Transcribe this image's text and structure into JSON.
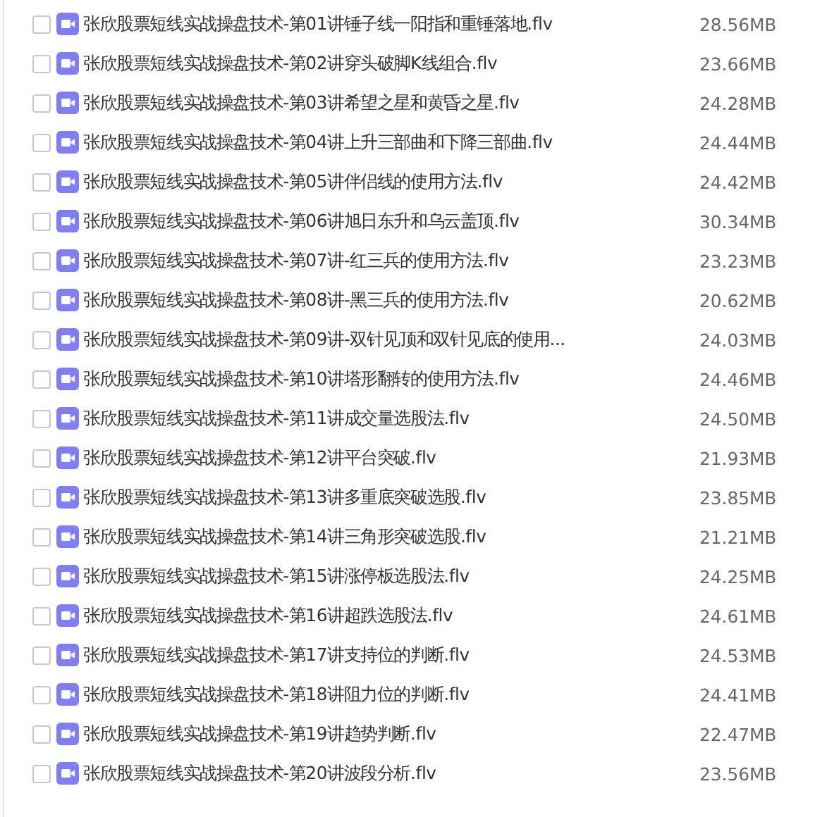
{
  "files": [
    {
      "name": "张欣股票短线实战操盘技术-第01讲锤子线一阳指和重锤落地.flv",
      "size": "28.56MB",
      "checked": false
    },
    {
      "name": "张欣股票短线实战操盘技术-第02讲穿头破脚K线组合.flv",
      "size": "23.66MB",
      "checked": false
    },
    {
      "name": "张欣股票短线实战操盘技术-第03讲希望之星和黄昏之星.flv",
      "size": "24.28MB",
      "checked": false
    },
    {
      "name": "张欣股票短线实战操盘技术-第04讲上升三部曲和下降三部曲.flv",
      "size": "24.44MB",
      "checked": false
    },
    {
      "name": "张欣股票短线实战操盘技术-第05讲伴侣线的使用方法.flv",
      "size": "24.42MB",
      "checked": false
    },
    {
      "name": "张欣股票短线实战操盘技术-第06讲旭日东升和乌云盖顶.flv",
      "size": "30.34MB",
      "checked": false
    },
    {
      "name": "张欣股票短线实战操盘技术-第07讲-红三兵的使用方法.flv",
      "size": "23.23MB",
      "checked": false
    },
    {
      "name": "张欣股票短线实战操盘技术-第08讲-黑三兵的使用方法.flv",
      "size": "20.62MB",
      "checked": false
    },
    {
      "name": "张欣股票短线实战操盘技术-第09讲-双针见顶和双针见底的使用...",
      "size": "24.03MB",
      "checked": false
    },
    {
      "name": "张欣股票短线实战操盘技术-第10讲塔形翻转的使用方法.flv",
      "size": "24.46MB",
      "checked": false
    },
    {
      "name": "张欣股票短线实战操盘技术-第11讲成交量选股法.flv",
      "size": "24.50MB",
      "checked": false
    },
    {
      "name": "张欣股票短线实战操盘技术-第12讲平台突破.flv",
      "size": "21.93MB",
      "checked": false
    },
    {
      "name": "张欣股票短线实战操盘技术-第13讲多重底突破选股.flv",
      "size": "23.85MB",
      "checked": false
    },
    {
      "name": "张欣股票短线实战操盘技术-第14讲三角形突破选股.flv",
      "size": "21.21MB",
      "checked": false
    },
    {
      "name": "张欣股票短线实战操盘技术-第15讲涨停板选股法.flv",
      "size": "24.25MB",
      "checked": false
    },
    {
      "name": "张欣股票短线实战操盘技术-第16讲超跌选股法.flv",
      "size": "24.61MB",
      "checked": false
    },
    {
      "name": "张欣股票短线实战操盘技术-第17讲支持位的判断.flv",
      "size": "24.53MB",
      "checked": false
    },
    {
      "name": "张欣股票短线实战操盘技术-第18讲阻力位的判断.flv",
      "size": "24.41MB",
      "checked": false
    },
    {
      "name": "张欣股票短线实战操盘技术-第19讲趋势判断.flv",
      "size": "22.47MB",
      "checked": false
    },
    {
      "name": "张欣股票短线实战操盘技术-第20讲波段分析.flv",
      "size": "23.56MB",
      "checked": false
    }
  ]
}
